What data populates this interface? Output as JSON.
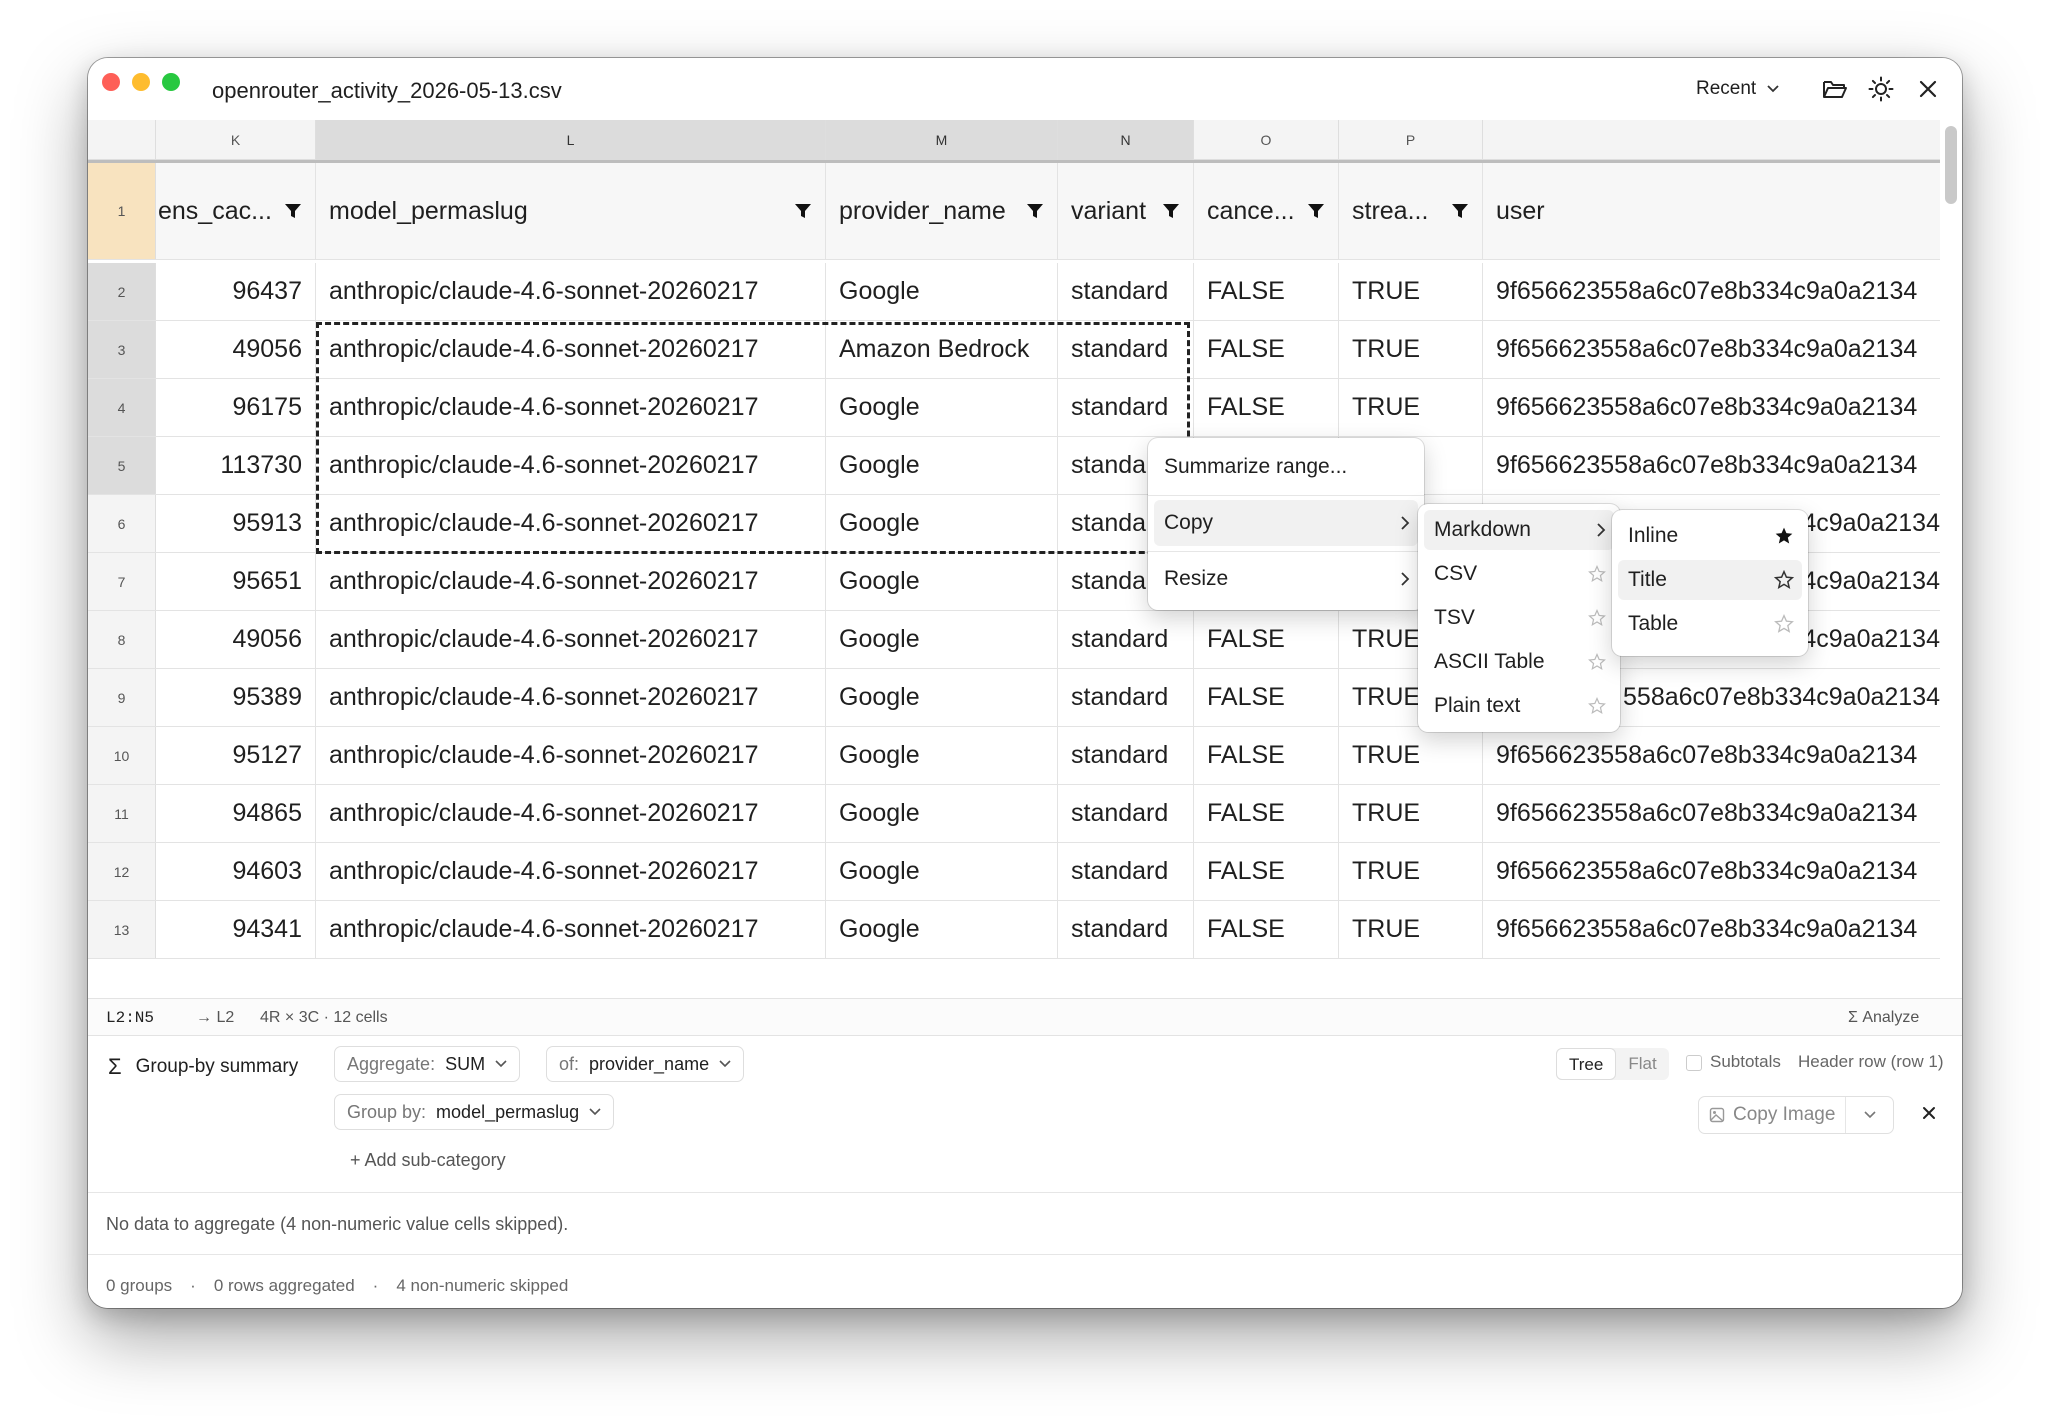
{
  "window": {
    "title": "openrouter_activity_2026-05-13.csv",
    "recent_label": "Recent"
  },
  "grid": {
    "column_letters": [
      "K",
      "L",
      "M",
      "N",
      "O",
      "P"
    ],
    "headers": [
      "ens_cac...",
      "model_permaslug",
      "provider_name",
      "variant",
      "cance...",
      "strea...",
      "user"
    ],
    "header_row_number": "1",
    "rows": [
      {
        "n": "2",
        "tokens": "96437",
        "model": "anthropic/claude-4.6-sonnet-20260217",
        "provider": "Google",
        "variant": "standard",
        "cancelled": "FALSE",
        "streamed": "TRUE",
        "user": "9f656623558a6c07e8b334c9a0a2134"
      },
      {
        "n": "3",
        "tokens": "49056",
        "model": "anthropic/claude-4.6-sonnet-20260217",
        "provider": "Amazon Bedrock",
        "variant": "standard",
        "cancelled": "FALSE",
        "streamed": "TRUE",
        "user": "9f656623558a6c07e8b334c9a0a2134"
      },
      {
        "n": "4",
        "tokens": "96175",
        "model": "anthropic/claude-4.6-sonnet-20260217",
        "provider": "Google",
        "variant": "standard",
        "cancelled": "FALSE",
        "streamed": "TRUE",
        "user": "9f656623558a6c07e8b334c9a0a2134"
      },
      {
        "n": "5",
        "tokens": "113730",
        "model": "anthropic/claude-4.6-sonnet-20260217",
        "provider": "Google",
        "variant": "standa",
        "cancelled": "",
        "streamed": "",
        "user": "9f656623558a6c07e8b334c9a0a2134"
      },
      {
        "n": "6",
        "tokens": "95913",
        "model": "anthropic/claude-4.6-sonnet-20260217",
        "provider": "Google",
        "variant": "standa",
        "cancelled": "",
        "streamed": "",
        "user": "4c9a0a2134"
      },
      {
        "n": "7",
        "tokens": "95651",
        "model": "anthropic/claude-4.6-sonnet-20260217",
        "provider": "Google",
        "variant": "standa",
        "cancelled": "",
        "streamed": "",
        "user": "4c9a0a2134"
      },
      {
        "n": "8",
        "tokens": "49056",
        "model": "anthropic/claude-4.6-sonnet-20260217",
        "provider": "Google",
        "variant": "standard",
        "cancelled": "FALSE",
        "streamed": "TRUE",
        "user": "4c9a0a2134"
      },
      {
        "n": "9",
        "tokens": "95389",
        "model": "anthropic/claude-4.6-sonnet-20260217",
        "provider": "Google",
        "variant": "standard",
        "cancelled": "FALSE",
        "streamed": "TRUE",
        "user": "558a6c07e8b334c9a0a2134"
      },
      {
        "n": "10",
        "tokens": "95127",
        "model": "anthropic/claude-4.6-sonnet-20260217",
        "provider": "Google",
        "variant": "standard",
        "cancelled": "FALSE",
        "streamed": "TRUE",
        "user": "9f656623558a6c07e8b334c9a0a2134"
      },
      {
        "n": "11",
        "tokens": "94865",
        "model": "anthropic/claude-4.6-sonnet-20260217",
        "provider": "Google",
        "variant": "standard",
        "cancelled": "FALSE",
        "streamed": "TRUE",
        "user": "9f656623558a6c07e8b334c9a0a2134"
      },
      {
        "n": "12",
        "tokens": "94603",
        "model": "anthropic/claude-4.6-sonnet-20260217",
        "provider": "Google",
        "variant": "standard",
        "cancelled": "FALSE",
        "streamed": "TRUE",
        "user": "9f656623558a6c07e8b334c9a0a2134"
      },
      {
        "n": "13",
        "tokens": "94341",
        "model": "anthropic/claude-4.6-sonnet-20260217",
        "provider": "Google",
        "variant": "standard",
        "cancelled": "FALSE",
        "streamed": "TRUE",
        "user": "9f656623558a6c07e8b334c9a0a2134"
      }
    ]
  },
  "context_menu": {
    "items": [
      "Summarize range...",
      "Copy",
      "Resize"
    ],
    "copy_submenu": [
      "Markdown",
      "CSV",
      "TSV",
      "ASCII Table",
      "Plain text"
    ],
    "markdown_submenu": [
      "Inline",
      "Title",
      "Table"
    ]
  },
  "statusbar": {
    "range": "L2:N5",
    "anchor": "→ L2",
    "size": "4R × 3C · 12 cells",
    "analyze": "Σ Analyze"
  },
  "groupby": {
    "title": "Group-by summary",
    "aggregate_label": "Aggregate:",
    "aggregate_value": "SUM",
    "of_label": "of:",
    "of_value": "provider_name",
    "groupby_label": "Group by:",
    "groupby_value": "model_permaslug",
    "add_sub": "+ Add sub-category",
    "tree_label": "Tree",
    "flat_label": "Flat",
    "subtotals_label": "Subtotals",
    "header_row_label": "Header row (row 1)",
    "copy_image_label": "Copy Image",
    "message": "No data to aggregate (4 non-numeric value cells skipped).",
    "footer_groups": "0 groups",
    "footer_rows": "0 rows aggregated",
    "footer_skipped": "4 non-numeric skipped",
    "footer_dot": "·"
  },
  "colors": {
    "header_row_highlight": "#f8e3bf",
    "selection_border": "#222222"
  }
}
